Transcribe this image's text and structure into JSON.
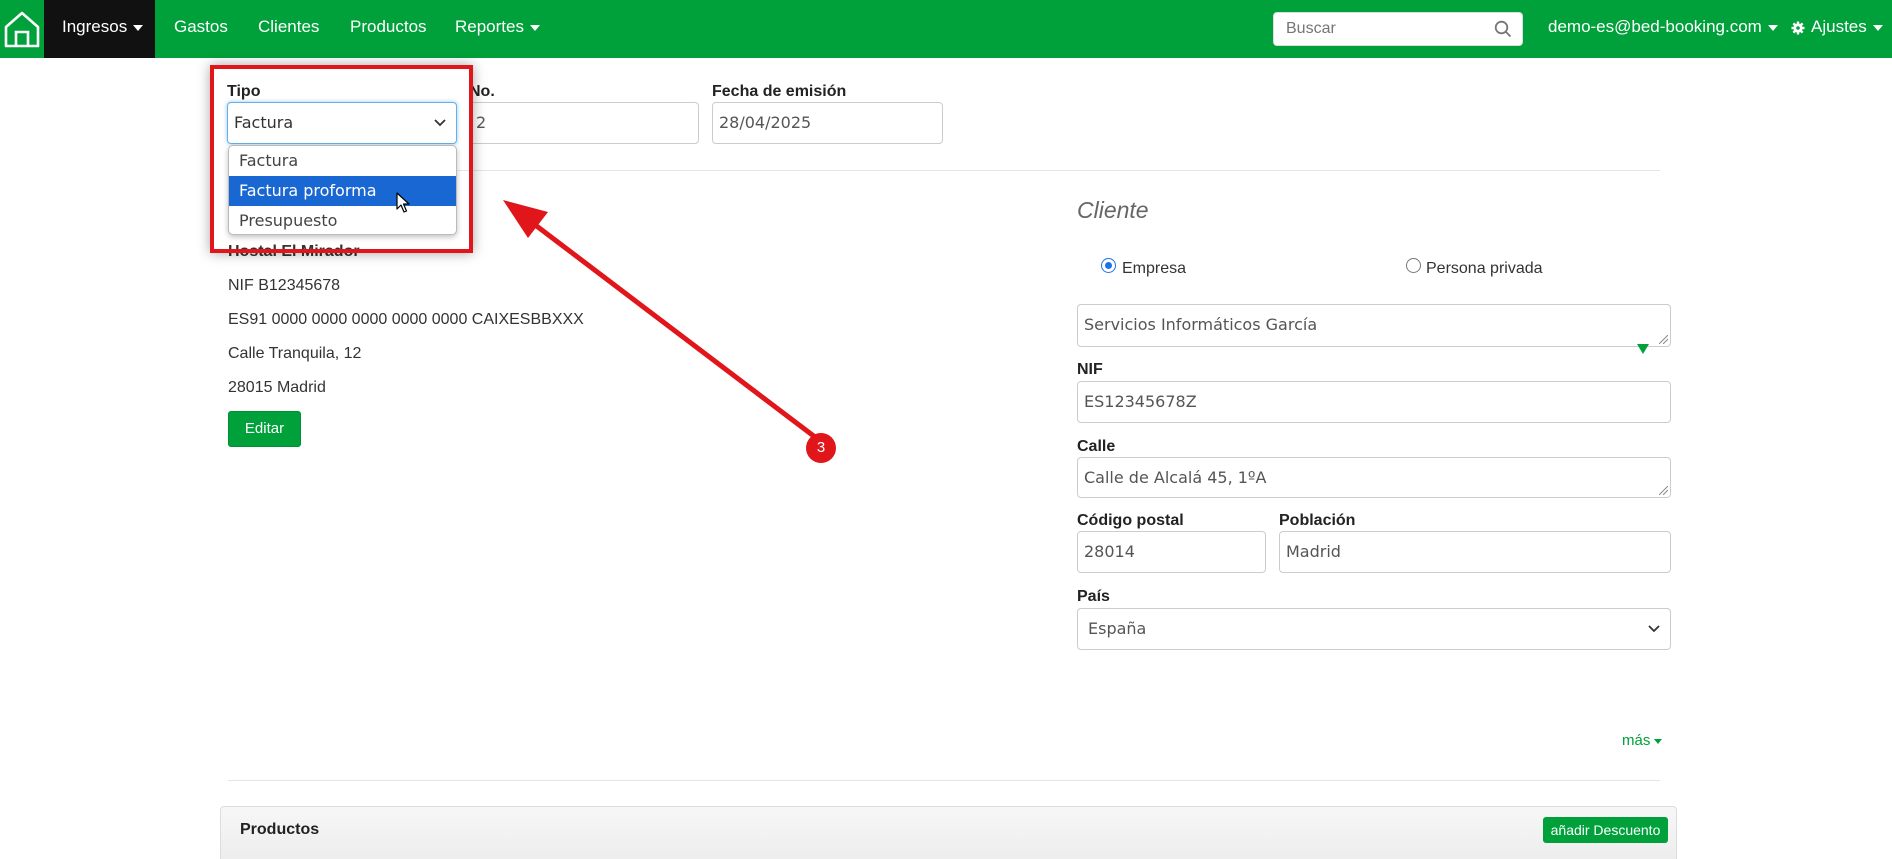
{
  "nav": {
    "items": [
      {
        "label": "Ingresos",
        "has_caret": true,
        "active": true
      },
      {
        "label": "Gastos"
      },
      {
        "label": "Clientes"
      },
      {
        "label": "Productos"
      },
      {
        "label": "Reportes",
        "has_caret": true
      }
    ],
    "search_placeholder": "Buscar",
    "user": "demo-es@bed-booking.com",
    "settings": "Ajustes",
    "colors": {
      "brand": "#00a13a",
      "active_bg": "#111111"
    }
  },
  "invoice": {
    "tipo_label": "Tipo",
    "tipo_value": "Factura",
    "no_label": "No.",
    "no_value": "2",
    "fecha_label": "Fecha de emisión",
    "fecha_value": "28/04/2025",
    "tipo_options": [
      "Factura",
      "Factura proforma",
      "Presupuesto"
    ],
    "tipo_highlighted": "Factura proforma"
  },
  "company": {
    "name": "Hostal El Mirador",
    "nif": "NIF B12345678",
    "iban": "ES91 0000 0000 0000 0000 0000 CAIXESBBXXX",
    "street": "Calle Tranquila, 12",
    "city": "28015 Madrid",
    "edit_label": "Editar"
  },
  "cliente": {
    "title": "Cliente",
    "radio_empresa": "Empresa",
    "radio_privada": "Persona privada",
    "name_value": "Servicios Informáticos García",
    "nif_label": "NIF",
    "nif_value": "ES12345678Z",
    "calle_label": "Calle",
    "calle_value": "Calle de Alcalá 45, 1ºA",
    "cp_label": "Código postal",
    "cp_value": "28014",
    "poblacion_label": "Población",
    "poblacion_value": "Madrid",
    "pais_label": "País",
    "pais_value": "España"
  },
  "more_label": "más",
  "productos": {
    "title": "Productos",
    "add_discount": "añadir Descuento"
  },
  "annotation": {
    "step": "3",
    "color": "#e0161b"
  }
}
